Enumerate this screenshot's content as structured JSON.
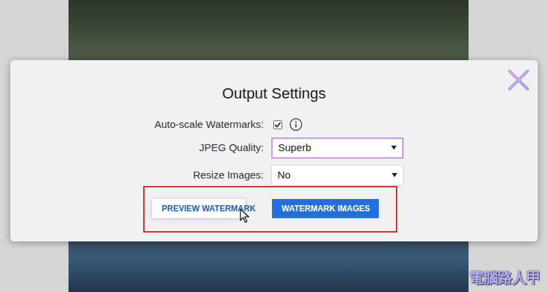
{
  "dialog": {
    "title": "Output Settings",
    "fields": [
      {
        "kind": "checkbox",
        "label": "Auto-scale Watermarks:",
        "checked": true,
        "focused": false,
        "value": ""
      },
      {
        "kind": "select",
        "label": "JPEG Quality:",
        "checked": false,
        "focused": true,
        "value": "Superb"
      },
      {
        "kind": "select",
        "label": "Resize Images:",
        "checked": false,
        "focused": false,
        "value": "No"
      }
    ],
    "buttons": [
      {
        "label": "PREVIEW WATERMARK",
        "primary": false,
        "hovered": true
      },
      {
        "label": "WATERMARK IMAGES",
        "primary": true,
        "hovered": false
      }
    ]
  },
  "watermark": "電腦路人甲"
}
